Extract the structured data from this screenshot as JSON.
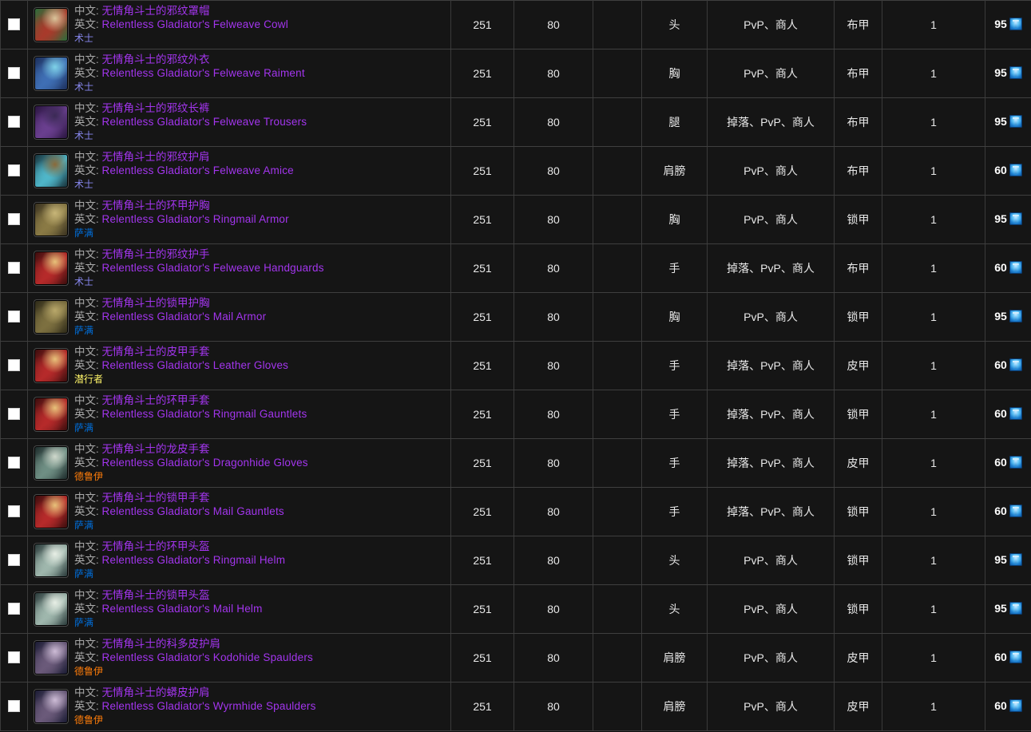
{
  "table": {
    "columns": [
      {
        "key": "check",
        "label": ""
      },
      {
        "key": "item",
        "label": ""
      },
      {
        "key": "ilvl",
        "label": ""
      },
      {
        "key": "level",
        "label": ""
      },
      {
        "key": "blank",
        "label": ""
      },
      {
        "key": "slot",
        "label": ""
      },
      {
        "key": "source",
        "label": ""
      },
      {
        "key": "armor",
        "label": ""
      },
      {
        "key": "qty",
        "label": ""
      },
      {
        "key": "cost",
        "label": ""
      }
    ],
    "labels": {
      "cn_prefix": "中文:",
      "en_prefix": "英文:"
    },
    "class_colors": {
      "术士": "#8787ed",
      "萨满": "#0070de",
      "潜行者": "#fff569",
      "德鲁伊": "#ff7d0a"
    },
    "quality_color": "#a335ee",
    "currency_icon": "arena-points-icon",
    "checkbox_icon": "checkbox-unchecked-icon",
    "rows": [
      {
        "checkbox": "checkbox-unchecked-icon",
        "icon": "item-icon-felweave-cowl",
        "icon_colors": [
          "#2c6b3a",
          "#a83a2b",
          "#d9c49a"
        ],
        "name_cn": "无情角斗士的邪纹罩帽",
        "name_en": "Relentless Gladiator's Felweave Cowl",
        "class": "术士",
        "ilvl": "251",
        "level": "80",
        "blank": "",
        "slot": "头",
        "source": "PvP、商人",
        "armor": "布甲",
        "qty": "1",
        "cost": "95"
      },
      {
        "checkbox": "checkbox-unchecked-icon",
        "icon": "item-icon-felweave-raiment",
        "icon_colors": [
          "#1c2f5c",
          "#3f6fb5",
          "#7fd2e8"
        ],
        "name_cn": "无情角斗士的邪纹外衣",
        "name_en": "Relentless Gladiator's Felweave Raiment",
        "class": "术士",
        "ilvl": "251",
        "level": "80",
        "blank": "",
        "slot": "胸",
        "source": "PvP、商人",
        "armor": "布甲",
        "qty": "1",
        "cost": "95"
      },
      {
        "checkbox": "checkbox-unchecked-icon",
        "icon": "item-icon-felweave-trousers",
        "icon_colors": [
          "#2a1540",
          "#6a3f8f",
          "#3b2a55"
        ],
        "name_cn": "无情角斗士的邪纹长裤",
        "name_en": "Relentless Gladiator's Felweave Trousers",
        "class": "术士",
        "ilvl": "251",
        "level": "80",
        "blank": "",
        "slot": "腿",
        "source": "掉落、PvP、商人",
        "armor": "布甲",
        "qty": "1",
        "cost": "95"
      },
      {
        "checkbox": "checkbox-unchecked-icon",
        "icon": "item-icon-felweave-amice",
        "icon_colors": [
          "#17323b",
          "#4fb6c9",
          "#8a6a3a"
        ],
        "name_cn": "无情角斗士的邪纹护肩",
        "name_en": "Relentless Gladiator's Felweave Amice",
        "class": "术士",
        "ilvl": "251",
        "level": "80",
        "blank": "",
        "slot": "肩膀",
        "source": "PvP、商人",
        "armor": "布甲",
        "qty": "1",
        "cost": "60"
      },
      {
        "checkbox": "checkbox-unchecked-icon",
        "icon": "item-icon-ringmail-armor",
        "icon_colors": [
          "#3a3220",
          "#8a7a45",
          "#c8b678"
        ],
        "name_cn": "无情角斗士的环甲护胸",
        "name_en": "Relentless Gladiator's Ringmail Armor",
        "class": "萨满",
        "ilvl": "251",
        "level": "80",
        "blank": "",
        "slot": "胸",
        "source": "PvP、商人",
        "armor": "锁甲",
        "qty": "1",
        "cost": "95"
      },
      {
        "checkbox": "checkbox-unchecked-icon",
        "icon": "item-icon-felweave-handguards",
        "icon_colors": [
          "#3b0d0d",
          "#b62a2a",
          "#e8c27a"
        ],
        "name_cn": "无情角斗士的邪纹护手",
        "name_en": "Relentless Gladiator's Felweave Handguards",
        "class": "术士",
        "ilvl": "251",
        "level": "80",
        "blank": "",
        "slot": "手",
        "source": "掉落、PvP、商人",
        "armor": "布甲",
        "qty": "1",
        "cost": "60"
      },
      {
        "checkbox": "checkbox-unchecked-icon",
        "icon": "item-icon-mail-armor",
        "icon_colors": [
          "#2e2a18",
          "#7d7040",
          "#b9a86a"
        ],
        "name_cn": "无情角斗士的锁甲护胸",
        "name_en": "Relentless Gladiator's Mail Armor",
        "class": "萨满",
        "ilvl": "251",
        "level": "80",
        "blank": "",
        "slot": "胸",
        "source": "PvP、商人",
        "armor": "锁甲",
        "qty": "1",
        "cost": "95"
      },
      {
        "checkbox": "checkbox-unchecked-icon",
        "icon": "item-icon-leather-gloves",
        "icon_colors": [
          "#3b0d0d",
          "#b62a2a",
          "#e8c27a"
        ],
        "name_cn": "无情角斗士的皮甲手套",
        "name_en": "Relentless Gladiator's Leather Gloves",
        "class": "潜行者",
        "ilvl": "251",
        "level": "80",
        "blank": "",
        "slot": "手",
        "source": "掉落、PvP、商人",
        "armor": "皮甲",
        "qty": "1",
        "cost": "60"
      },
      {
        "checkbox": "checkbox-unchecked-icon",
        "icon": "item-icon-ringmail-gauntlets",
        "icon_colors": [
          "#3b0d0d",
          "#b62a2a",
          "#e8c27a"
        ],
        "name_cn": "无情角斗士的环甲手套",
        "name_en": "Relentless Gladiator's Ringmail Gauntlets",
        "class": "萨满",
        "ilvl": "251",
        "level": "80",
        "blank": "",
        "slot": "手",
        "source": "掉落、PvP、商人",
        "armor": "锁甲",
        "qty": "1",
        "cost": "60"
      },
      {
        "checkbox": "checkbox-unchecked-icon",
        "icon": "item-icon-dragonhide-gloves",
        "icon_colors": [
          "#1d2b2b",
          "#6f8f84",
          "#cfd8cc"
        ],
        "name_cn": "无情角斗士的龙皮手套",
        "name_en": "Relentless Gladiator's Dragonhide Gloves",
        "class": "德鲁伊",
        "ilvl": "251",
        "level": "80",
        "blank": "",
        "slot": "手",
        "source": "掉落、PvP、商人",
        "armor": "皮甲",
        "qty": "1",
        "cost": "60"
      },
      {
        "checkbox": "checkbox-unchecked-icon",
        "icon": "item-icon-mail-gauntlets",
        "icon_colors": [
          "#3b0d0d",
          "#b62a2a",
          "#e8c27a"
        ],
        "name_cn": "无情角斗士的锁甲手套",
        "name_en": "Relentless Gladiator's Mail Gauntlets",
        "class": "萨满",
        "ilvl": "251",
        "level": "80",
        "blank": "",
        "slot": "手",
        "source": "掉落、PvP、商人",
        "armor": "锁甲",
        "qty": "1",
        "cost": "60"
      },
      {
        "checkbox": "checkbox-unchecked-icon",
        "icon": "item-icon-ringmail-helm",
        "icon_colors": [
          "#2a3a3a",
          "#9fb7ad",
          "#e8efe6"
        ],
        "name_cn": "无情角斗士的环甲头盔",
        "name_en": "Relentless Gladiator's Ringmail Helm",
        "class": "萨满",
        "ilvl": "251",
        "level": "80",
        "blank": "",
        "slot": "头",
        "source": "PvP、商人",
        "armor": "锁甲",
        "qty": "1",
        "cost": "95"
      },
      {
        "checkbox": "checkbox-unchecked-icon",
        "icon": "item-icon-mail-helm",
        "icon_colors": [
          "#2a3a3a",
          "#9fb7ad",
          "#e8efe6"
        ],
        "name_cn": "无情角斗士的锁甲头盔",
        "name_en": "Relentless Gladiator's Mail Helm",
        "class": "萨满",
        "ilvl": "251",
        "level": "80",
        "blank": "",
        "slot": "头",
        "source": "PvP、商人",
        "armor": "锁甲",
        "qty": "1",
        "cost": "95"
      },
      {
        "checkbox": "checkbox-unchecked-icon",
        "icon": "item-icon-kodohide-spaulders",
        "icon_colors": [
          "#1a1b33",
          "#6b5a7a",
          "#cdbcd6"
        ],
        "name_cn": "无情角斗士的科多皮护肩",
        "name_en": "Relentless Gladiator's Kodohide Spaulders",
        "class": "德鲁伊",
        "ilvl": "251",
        "level": "80",
        "blank": "",
        "slot": "肩膀",
        "source": "PvP、商人",
        "armor": "皮甲",
        "qty": "1",
        "cost": "60"
      },
      {
        "checkbox": "checkbox-unchecked-icon",
        "icon": "item-icon-wyrmhide-spaulders",
        "icon_colors": [
          "#1a1b33",
          "#6b5a7a",
          "#cdbcd6"
        ],
        "name_cn": "无情角斗士的蟒皮护肩",
        "name_en": "Relentless Gladiator's Wyrmhide Spaulders",
        "class": "德鲁伊",
        "ilvl": "251",
        "level": "80",
        "blank": "",
        "slot": "肩膀",
        "source": "PvP、商人",
        "armor": "皮甲",
        "qty": "1",
        "cost": "60"
      }
    ]
  }
}
